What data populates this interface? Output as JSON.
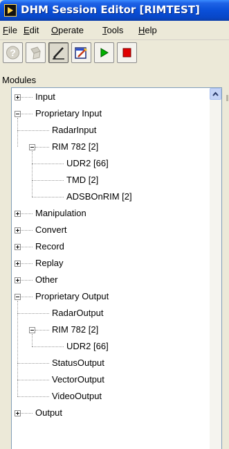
{
  "window": {
    "title": "DHM Session Editor [RIMTEST]",
    "title_bar_color": "#0a4fd8"
  },
  "menu": [
    {
      "key": "F",
      "rest": "ile"
    },
    {
      "key": "E",
      "rest": "dit"
    },
    {
      "key": "O",
      "rest": "perate"
    },
    {
      "key": "T",
      "rest": "ools"
    },
    {
      "key": "H",
      "rest": "elp"
    }
  ],
  "toolbar": {
    "buttons": [
      {
        "name": "help-button",
        "icon": "help-icon"
      },
      {
        "name": "disabled-tool-button",
        "icon": "tool-icon"
      },
      {
        "name": "edit-pen-button",
        "icon": "pen-icon",
        "pressed": true
      },
      {
        "name": "edit-session-button",
        "icon": "edit-icon"
      },
      {
        "name": "run-button",
        "icon": "play-icon",
        "color": "#00b000"
      },
      {
        "name": "stop-button",
        "icon": "stop-icon",
        "color": "#e00000"
      }
    ]
  },
  "modules": {
    "label": "Modules",
    "tree": [
      {
        "label": "Input",
        "level": 0,
        "expander": "plus"
      },
      {
        "label": "Proprietary Input",
        "level": 0,
        "expander": "minus"
      },
      {
        "label": "RadarInput",
        "level": 1,
        "expander": "none"
      },
      {
        "label": "RIM 782 [2]",
        "level": 1,
        "expander": "minus"
      },
      {
        "label": "UDR2 [66]",
        "level": 2,
        "expander": "none"
      },
      {
        "label": "TMD [2]",
        "level": 2,
        "expander": "none"
      },
      {
        "label": "ADSBOnRIM [2]",
        "level": 2,
        "expander": "none"
      },
      {
        "label": "Manipulation",
        "level": 0,
        "expander": "plus"
      },
      {
        "label": "Convert",
        "level": 0,
        "expander": "plus"
      },
      {
        "label": "Record",
        "level": 0,
        "expander": "plus"
      },
      {
        "label": "Replay",
        "level": 0,
        "expander": "plus"
      },
      {
        "label": "Other",
        "level": 0,
        "expander": "plus"
      },
      {
        "label": "Proprietary Output",
        "level": 0,
        "expander": "minus"
      },
      {
        "label": "RadarOutput",
        "level": 1,
        "expander": "none"
      },
      {
        "label": "RIM 782 [2]",
        "level": 1,
        "expander": "minus"
      },
      {
        "label": "UDR2 [66]",
        "level": 2,
        "expander": "none"
      },
      {
        "label": "StatusOutput",
        "level": 1,
        "expander": "none"
      },
      {
        "label": "VectorOutput",
        "level": 1,
        "expander": "none"
      },
      {
        "label": "VideoOutput",
        "level": 1,
        "expander": "none"
      },
      {
        "label": "Output",
        "level": 0,
        "expander": "plus"
      }
    ]
  }
}
